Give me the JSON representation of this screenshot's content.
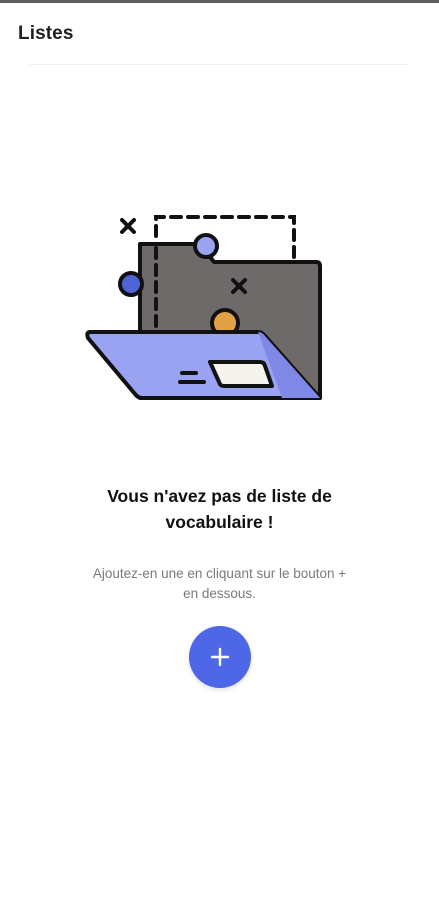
{
  "app_bar": {
    "title": "Listes"
  },
  "empty_state": {
    "illustration_icon": "open-folder-icon",
    "title_line1": "Vous n'avez pas de liste de",
    "title_line2": "vocabulaire !",
    "subtitle_line1": "Ajoutez-en une en cliquant sur le bouton +",
    "subtitle_line2": "en dessous."
  },
  "fab": {
    "icon": "plus-icon",
    "color": "#4d67e6"
  },
  "colors": {
    "folder_back": "#6e6a6a",
    "folder_front": "#9aa3f2",
    "circle_blue": "#4f64d8",
    "circle_orange": "#e2a145"
  }
}
